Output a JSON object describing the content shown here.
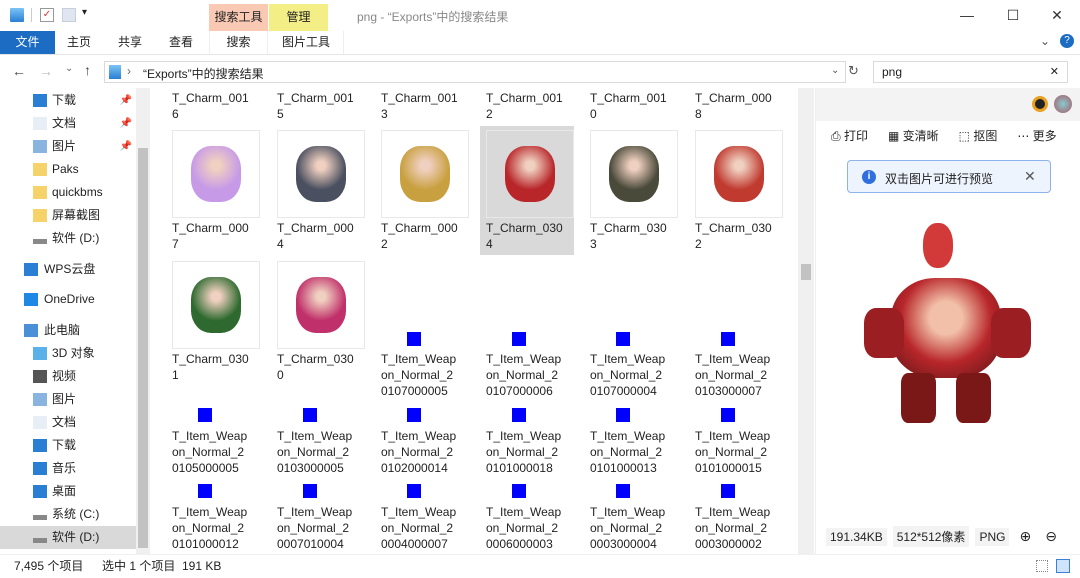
{
  "window": {
    "title": "png - “Exports”中的搜索结果",
    "minimize": "—",
    "maximize": "☐",
    "close": "✕",
    "help": "?",
    "collapse": "⌄"
  },
  "ribbon": {
    "context_search": "搜索工具",
    "context_manage": "管理",
    "tabs": [
      "文件",
      "主页",
      "共享",
      "查看",
      "搜索",
      "图片工具"
    ],
    "context_search_color": "#f9c9b4",
    "context_manage_color": "#f3ef86"
  },
  "address": {
    "path": "“Exports”中的搜索结果",
    "search_value": "png",
    "back": "←",
    "forward": "→",
    "up": "↑",
    "recent": "⌄"
  },
  "nav": [
    {
      "label": "下载",
      "icon": "download-icon",
      "pinned": true
    },
    {
      "label": "文档",
      "icon": "document-icon",
      "pinned": true
    },
    {
      "label": "图片",
      "icon": "picture-icon",
      "pinned": true
    },
    {
      "label": "Paks",
      "icon": "folder-icon"
    },
    {
      "label": "quickbms",
      "icon": "folder-icon"
    },
    {
      "label": "屏幕截图",
      "icon": "folder-icon"
    },
    {
      "label": "软件 (D:)",
      "icon": "drive-icon"
    },
    {
      "label": "WPS云盘",
      "icon": "cloud-icon"
    },
    {
      "label": "OneDrive",
      "icon": "onedrive-icon"
    },
    {
      "label": "此电脑",
      "icon": "computer-icon"
    },
    {
      "label": "3D 对象",
      "icon": "3d-icon"
    },
    {
      "label": "视频",
      "icon": "video-icon"
    },
    {
      "label": "图片",
      "icon": "picture-icon"
    },
    {
      "label": "文档",
      "icon": "document-icon"
    },
    {
      "label": "下载",
      "icon": "download-icon"
    },
    {
      "label": "音乐",
      "icon": "music-icon"
    },
    {
      "label": "桌面",
      "icon": "desktop-icon"
    },
    {
      "label": "系统 (C:)",
      "icon": "drive-icon"
    },
    {
      "label": "软件 (D:)",
      "icon": "drive-icon",
      "selected": true
    }
  ],
  "files": [
    {
      "name": "T_Charm_0016",
      "kind": "label"
    },
    {
      "name": "T_Charm_0015",
      "kind": "label"
    },
    {
      "name": "T_Charm_0013",
      "kind": "label"
    },
    {
      "name": "T_Charm_0012",
      "kind": "label"
    },
    {
      "name": "T_Charm_0010",
      "kind": "label"
    },
    {
      "name": "T_Charm_0008",
      "kind": "label"
    },
    {
      "name": "T_Charm_0007",
      "kind": "thumb",
      "color": "#c79ae8"
    },
    {
      "name": "T_Charm_0004",
      "kind": "thumb",
      "color": "#4a5060"
    },
    {
      "name": "T_Charm_0002",
      "kind": "thumb",
      "color": "#c9a040"
    },
    {
      "name": "T_Charm_0304",
      "kind": "thumb",
      "color": "#b8262a",
      "selected": true
    },
    {
      "name": "T_Charm_0303",
      "kind": "thumb",
      "color": "#4a4a3a"
    },
    {
      "name": "T_Charm_0302",
      "kind": "thumb",
      "color": "#c03a30"
    },
    {
      "name": "T_Charm_0301",
      "kind": "thumb",
      "color": "#2e6a30"
    },
    {
      "name": "T_Charm_0300",
      "kind": "thumb",
      "color": "#c0306a"
    },
    {
      "name": "T_Item_Weapon_Normal_20107000005",
      "kind": "small"
    },
    {
      "name": "T_Item_Weapon_Normal_20107000006",
      "kind": "small"
    },
    {
      "name": "T_Item_Weapon_Normal_20107000004",
      "kind": "small"
    },
    {
      "name": "T_Item_Weapon_Normal_20103000007",
      "kind": "small"
    },
    {
      "name": "T_Item_Weapon_Normal_20105000005",
      "kind": "small"
    },
    {
      "name": "T_Item_Weapon_Normal_20103000005",
      "kind": "small"
    },
    {
      "name": "T_Item_Weapon_Normal_20102000014",
      "kind": "small"
    },
    {
      "name": "T_Item_Weapon_Normal_20101000018",
      "kind": "small"
    },
    {
      "name": "T_Item_Weapon_Normal_20101000013",
      "kind": "small"
    },
    {
      "name": "T_Item_Weapon_Normal_20101000015",
      "kind": "small"
    },
    {
      "name": "T_Item_Weapon_Normal_20101000012",
      "kind": "small"
    },
    {
      "name": "T_Item_Weapon_Normal_20007010004",
      "kind": "small"
    },
    {
      "name": "T_Item_Weapon_Normal_20004000007",
      "kind": "small"
    },
    {
      "name": "T_Item_Weapon_Normal_20006000003",
      "kind": "small"
    },
    {
      "name": "T_Item_Weapon_Normal_20003000004",
      "kind": "small"
    },
    {
      "name": "T_Item_Weapon_Normal_20003000002",
      "kind": "small"
    }
  ],
  "preview": {
    "toolbar": [
      {
        "label": "打印",
        "icon": "print-icon"
      },
      {
        "label": "变清晰",
        "icon": "enhance-icon"
      },
      {
        "label": "抠图",
        "icon": "cutout-icon"
      },
      {
        "label": "更多",
        "icon": "more-icon"
      }
    ],
    "notice": "双击图片可进行预览",
    "file_size": "191.34KB",
    "dimensions": "512*512像素",
    "format": "PNG"
  },
  "status": {
    "count": "7,495 个项目",
    "selected": "选中 1 个项目",
    "size": "191 KB"
  }
}
